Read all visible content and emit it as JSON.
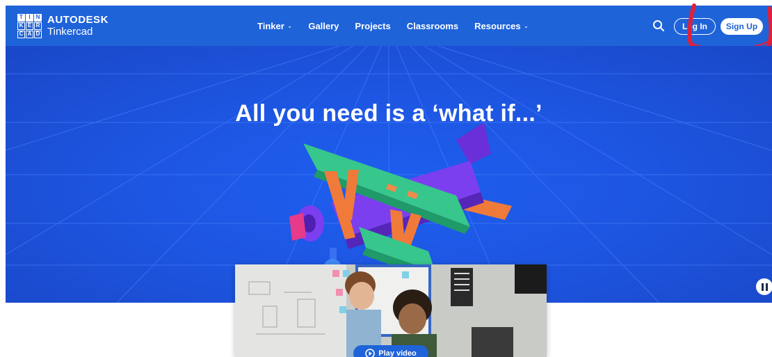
{
  "brand": {
    "logo_letters": [
      "T",
      "I",
      "N",
      "K",
      "E",
      "R",
      "C",
      "A",
      "D"
    ],
    "company": "AUTODESK",
    "product": "Tinkercad"
  },
  "nav": {
    "items": [
      {
        "label": "Tinker",
        "dropdown": true
      },
      {
        "label": "Gallery",
        "dropdown": false
      },
      {
        "label": "Projects",
        "dropdown": false
      },
      {
        "label": "Classrooms",
        "dropdown": false
      },
      {
        "label": "Resources",
        "dropdown": true
      }
    ],
    "dropdown_glyph": "⌄",
    "search_icon": "search-icon",
    "login_label": "Log In",
    "signup_label": "Sign Up"
  },
  "hero": {
    "headline": "All you need is a ‘what if...’",
    "pause_icon": "pause-icon"
  },
  "video": {
    "play_label": "Play video",
    "play_icon": "play-circle-icon"
  },
  "colors": {
    "brand_blue": "#1f63d9",
    "hero_blue": "#1d55e0",
    "annotation_red": "#e0203a"
  }
}
